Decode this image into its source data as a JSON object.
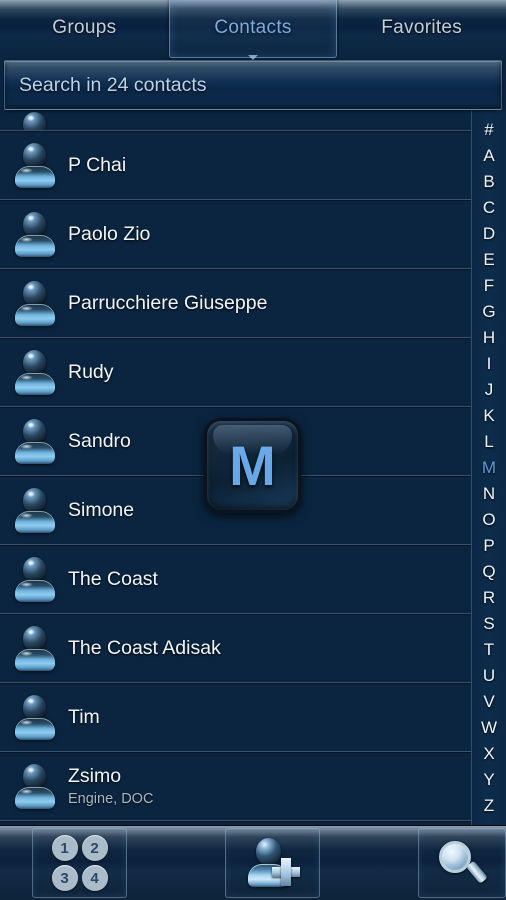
{
  "app": {
    "title": "Contacts",
    "accent_color": "#68a8e8",
    "background_color": "#0b2540",
    "text_color": "#f2f6fa"
  },
  "tabs": [
    {
      "label": "Groups",
      "active": false,
      "name": "tab-groups"
    },
    {
      "label": "Contacts",
      "active": true,
      "name": "tab-contacts"
    },
    {
      "label": "Favorites",
      "active": false,
      "name": "tab-favorites"
    }
  ],
  "search": {
    "placeholder": "Search in 24 contacts",
    "value": "",
    "contact_count": 24
  },
  "list": {
    "clipped_top_row": true,
    "contacts": [
      {
        "name": "P Chai",
        "subtitle": ""
      },
      {
        "name": "Paolo Zio",
        "subtitle": ""
      },
      {
        "name": "Parrucchiere Giuseppe",
        "subtitle": ""
      },
      {
        "name": "Rudy",
        "subtitle": ""
      },
      {
        "name": "Sandro",
        "subtitle": ""
      },
      {
        "name": "Simone",
        "subtitle": ""
      },
      {
        "name": "The Coast",
        "subtitle": ""
      },
      {
        "name": "The Coast Adisak",
        "subtitle": ""
      },
      {
        "name": "Tim",
        "subtitle": ""
      },
      {
        "name": "Zsimo",
        "subtitle": "Engine, DOC"
      }
    ]
  },
  "scrubber": {
    "selected": "M",
    "letters": [
      "#",
      "A",
      "B",
      "C",
      "D",
      "E",
      "F",
      "G",
      "H",
      "I",
      "J",
      "K",
      "L",
      "M",
      "N",
      "O",
      "P",
      "Q",
      "R",
      "S",
      "T",
      "U",
      "V",
      "W",
      "X",
      "Y",
      "Z"
    ]
  },
  "overlay": {
    "letter": "M",
    "visible": true
  },
  "bottom_bar": {
    "buttons": [
      {
        "name": "dialpad-button",
        "icon": "dialpad-icon",
        "keys": [
          "1",
          "2",
          "3",
          "4"
        ]
      },
      {
        "name": "add-contact-button",
        "icon": "add-contact-icon"
      },
      {
        "name": "search-button",
        "icon": "search-icon"
      }
    ]
  }
}
